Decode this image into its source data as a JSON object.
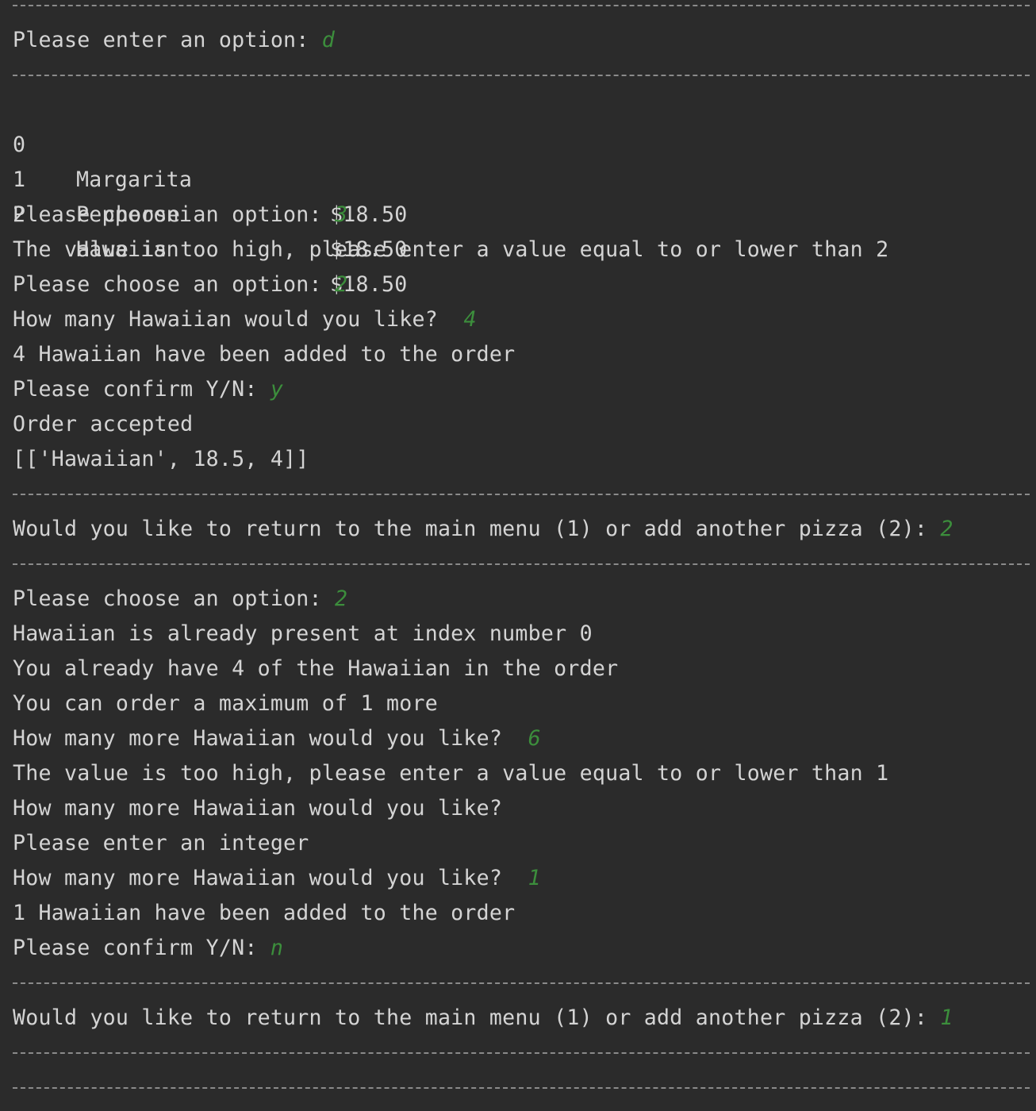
{
  "colors": {
    "background": "#2b2b2b",
    "output_text": "#d4d4d4",
    "user_input": "#3c8e3c",
    "separator": "#8a8a8a"
  },
  "lines": {
    "enter_option_prompt": "Please enter an option: ",
    "enter_option_input": "d",
    "menu": [
      {
        "index": "0",
        "name": "Margarita",
        "price": "$18.50"
      },
      {
        "index": "1",
        "name": "Pepperoni",
        "price": "$18.50"
      },
      {
        "index": "2",
        "name": "Hawaiian",
        "price": "$18.50"
      }
    ],
    "choose_prompt_1": "Please choose an option: ",
    "choose_input_1": "3",
    "too_high_1": "The value is too high, please enter a value equal to or lower than 2",
    "choose_prompt_2": "Please choose an option: ",
    "choose_input_2": "2",
    "how_many_prompt": "How many Hawaiian would you like?  ",
    "how_many_input": "4",
    "added_1": "4 Hawaiian have been added to the order",
    "confirm_prompt_1": "Please confirm Y/N: ",
    "confirm_input_1": "y",
    "order_accepted": "Order accepted",
    "order_list": "[['Hawaiian', 18.5, 4]]",
    "return_prompt_1": "Would you like to return to the main menu (1) or add another pizza (2): ",
    "return_input_1": "2",
    "choose_prompt_3": "Please choose an option: ",
    "choose_input_3": "2",
    "already_present": "Hawaiian is already present at index number 0",
    "already_have": "You already have 4 of the Hawaiian in the order",
    "max_more": "You can order a maximum of 1 more",
    "how_many_more_prompt_1": "How many more Hawaiian would you like?  ",
    "how_many_more_input_1": "6",
    "too_high_2": "The value is too high, please enter a value equal to or lower than 1",
    "how_many_more_prompt_2": "How many more Hawaiian would you like?",
    "enter_integer": "Please enter an integer",
    "how_many_more_prompt_3": "How many more Hawaiian would you like?  ",
    "how_many_more_input_3": "1",
    "added_2": "1 Hawaiian have been added to the order",
    "confirm_prompt_2": "Please confirm Y/N: ",
    "confirm_input_2": "n",
    "return_prompt_2": "Would you like to return to the main menu (1) or add another pizza (2): ",
    "return_input_2": "1"
  }
}
